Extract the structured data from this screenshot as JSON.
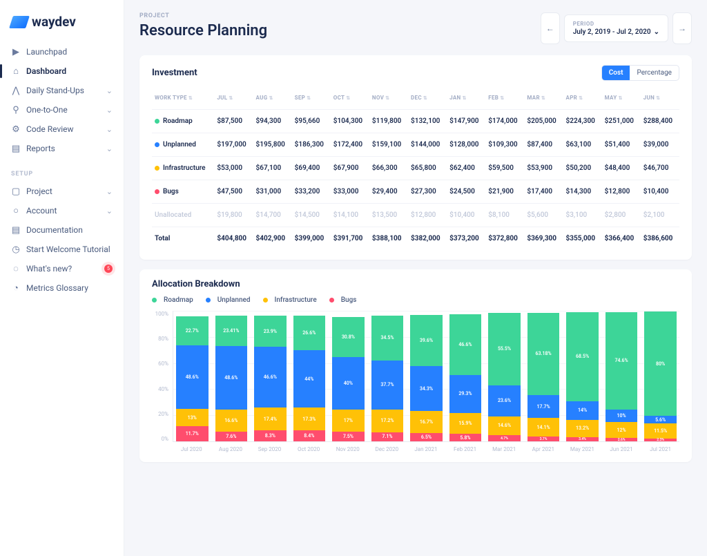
{
  "brand": "waydev",
  "sidebar": {
    "main": [
      {
        "icon": "▶",
        "label": "Launchpad"
      },
      {
        "icon": "⌂",
        "label": "Dashboard",
        "active": true
      },
      {
        "icon": "⋀",
        "label": "Daily Stand-Ups",
        "expandable": true
      },
      {
        "icon": "⚲",
        "label": "One-to-One",
        "expandable": true
      },
      {
        "icon": "⚙",
        "label": "Code Review",
        "expandable": true
      },
      {
        "icon": "▤",
        "label": "Reports",
        "expandable": true
      }
    ],
    "setupLabel": "SETUP",
    "setup": [
      {
        "icon": "▢",
        "label": "Project",
        "expandable": true
      },
      {
        "icon": "○",
        "label": "Account",
        "expandable": true
      },
      {
        "icon": "▤",
        "label": "Documentation"
      },
      {
        "icon": "◷",
        "label": "Start Welcome Tutorial"
      },
      {
        "icon": "◌",
        "label": "What's new?",
        "badge": "5"
      },
      {
        "icon": "◔",
        "label": "Metrics Glossary"
      }
    ]
  },
  "header": {
    "eyebrow": "PROJECT",
    "title": "Resource Planning",
    "periodLabel": "PERIOD",
    "periodValue": "July 2, 2019 - Jul 2, 2020"
  },
  "investment": {
    "title": "Investment",
    "toggle": {
      "cost": "Cost",
      "percentage": "Percentage",
      "active": "cost"
    },
    "columns": [
      "WORK TYPE",
      "JUL",
      "AUG",
      "SEP",
      "OCT",
      "NOV",
      "DEC",
      "JAN",
      "FEB",
      "MAR",
      "APR",
      "MAY",
      "JUN"
    ],
    "rows": [
      {
        "name": "Roadmap",
        "color": "#3dd598",
        "values": [
          "$87,500",
          "$94,300",
          "$95,660",
          "$104,300",
          "$119,800",
          "$132,100",
          "$147,900",
          "$174,000",
          "$205,000",
          "$224,300",
          "$251,000",
          "$288,400"
        ]
      },
      {
        "name": "Unplanned",
        "color": "#2680ff",
        "values": [
          "$197,000",
          "$195,800",
          "$186,300",
          "$172,400",
          "$159,100",
          "$144,000",
          "$128,000",
          "$109,300",
          "$87,400",
          "$63,100",
          "$51,400",
          "$39,000"
        ]
      },
      {
        "name": "Infrastructure",
        "color": "#ffc107",
        "values": [
          "$53,000",
          "$67,100",
          "$69,400",
          "$67,900",
          "$66,300",
          "$65,800",
          "$62,400",
          "$59,500",
          "$53,900",
          "$50,200",
          "$48,400",
          "$46,700"
        ]
      },
      {
        "name": "Bugs",
        "color": "#ff4d6d",
        "values": [
          "$47,500",
          "$31,000",
          "$33,200",
          "$33,000",
          "$29,400",
          "$27,300",
          "$24,500",
          "$21,900",
          "$17,400",
          "$14,300",
          "$12,800",
          "$10,400"
        ]
      },
      {
        "name": "Unallocated",
        "muted": true,
        "values": [
          "$19,800",
          "$14,700",
          "$14,500",
          "$14,100",
          "$13,500",
          "$12,800",
          "$10,400",
          "$8,100",
          "$5,600",
          "$3,100",
          "$2,800",
          "$2,100"
        ]
      }
    ],
    "total": {
      "label": "Total",
      "values": [
        "$404,800",
        "$402,900",
        "$399,000",
        "$391,700",
        "$388,100",
        "$382,000",
        "$373,200",
        "$372,800",
        "$369,300",
        "$355,000",
        "$366,400",
        "$386,600"
      ]
    }
  },
  "allocation": {
    "title": "Allocation Breakdown",
    "legend": [
      {
        "label": "Roadmap",
        "color": "#3dd598"
      },
      {
        "label": "Unplanned",
        "color": "#2680ff"
      },
      {
        "label": "Infrastructure",
        "color": "#ffc107"
      },
      {
        "label": "Bugs",
        "color": "#ff4d6d"
      }
    ],
    "yticks": [
      "100%",
      "80%",
      "60%",
      "40%",
      "20%",
      "0%"
    ],
    "months": [
      "Jul 2020",
      "Aug 2020",
      "Sep 2020",
      "Oct 2020",
      "Nov 2020",
      "Dec 2020",
      "Jan 2021",
      "Feb 2021",
      "Mar 2021",
      "Apr 2021",
      "May 2021",
      "Jun 2021",
      "Jul 2021"
    ]
  },
  "chart_data": {
    "type": "bar",
    "stacked": true,
    "categories": [
      "Jul 2020",
      "Aug 2020",
      "Sep 2020",
      "Oct 2020",
      "Nov 2020",
      "Dec 2020",
      "Jan 2021",
      "Feb 2021",
      "Mar 2021",
      "Apr 2021",
      "May 2021",
      "Jun 2021",
      "Jul 2021"
    ],
    "series": [
      {
        "name": "Roadmap",
        "color": "#3dd598",
        "values": [
          22.7,
          23.41,
          23.9,
          26.6,
          30.8,
          34.5,
          39.6,
          46.6,
          55.5,
          63.18,
          68.5,
          74.6,
          80
        ]
      },
      {
        "name": "Unplanned",
        "color": "#2680ff",
        "values": [
          48.6,
          48.6,
          46.6,
          44,
          40,
          37.7,
          34.3,
          29.3,
          23.6,
          17.7,
          14,
          10,
          5.6
        ]
      },
      {
        "name": "Infrastructure",
        "color": "#ffc107",
        "values": [
          13,
          16.6,
          17.4,
          17.3,
          17,
          17.2,
          16.7,
          15.9,
          14.6,
          14.1,
          13.2,
          12,
          11.5
        ]
      },
      {
        "name": "Bugs",
        "color": "#ff4d6d",
        "values": [
          11.7,
          7.6,
          8.3,
          8.4,
          7.5,
          7.1,
          6.5,
          5.8,
          4.7,
          3.7,
          3.4,
          2.6,
          2.3
        ]
      }
    ],
    "title": "Allocation Breakdown",
    "ylabel": "%",
    "ylim": [
      0,
      100
    ]
  }
}
